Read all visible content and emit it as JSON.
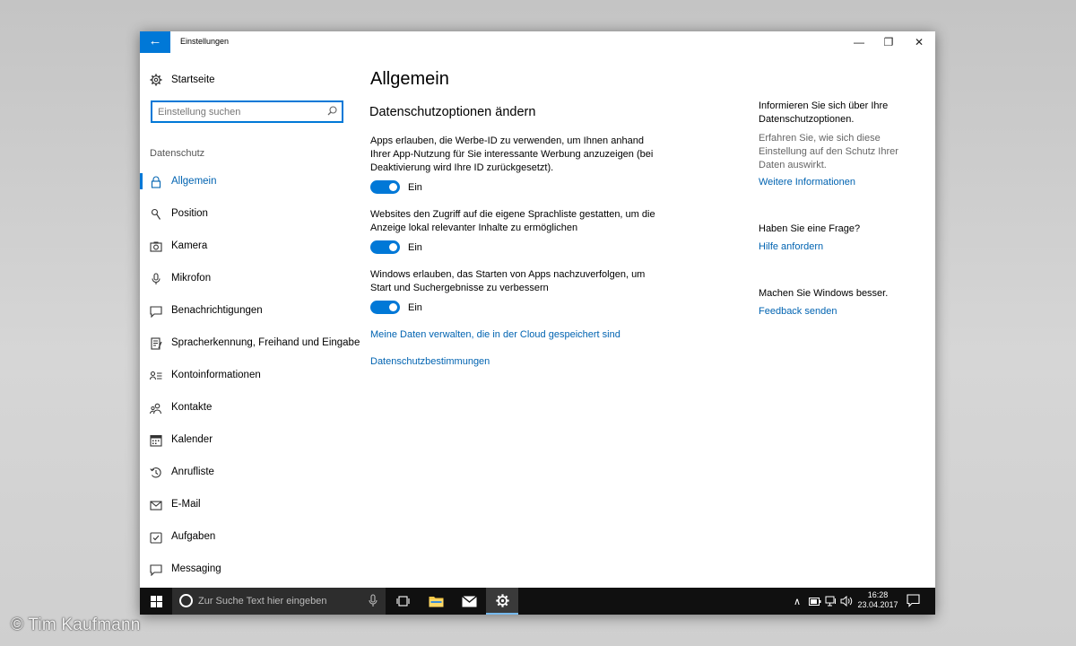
{
  "window": {
    "title": "Einstellungen",
    "back_glyph": "←",
    "minimize_glyph": "—",
    "maximize_glyph": "❐",
    "close_glyph": "✕"
  },
  "sidebar": {
    "home_label": "Startseite",
    "search_placeholder": "Einstellung suchen",
    "section_label": "Datenschutz",
    "items": [
      {
        "label": "Allgemein",
        "icon": "lock-icon",
        "active": true
      },
      {
        "label": "Position",
        "icon": "location-icon"
      },
      {
        "label": "Kamera",
        "icon": "camera-icon"
      },
      {
        "label": "Mikrofon",
        "icon": "microphone-icon"
      },
      {
        "label": "Benachrichtigungen",
        "icon": "notification-icon"
      },
      {
        "label": "Spracherkennung, Freihand und Eingabe",
        "icon": "speech-icon"
      },
      {
        "label": "Kontoinformationen",
        "icon": "account-info-icon"
      },
      {
        "label": "Kontakte",
        "icon": "contacts-icon"
      },
      {
        "label": "Kalender",
        "icon": "calendar-icon"
      },
      {
        "label": "Anrufliste",
        "icon": "call-history-icon"
      },
      {
        "label": "E-Mail",
        "icon": "mail-icon"
      },
      {
        "label": "Aufgaben",
        "icon": "tasks-icon"
      },
      {
        "label": "Messaging",
        "icon": "messaging-icon"
      }
    ]
  },
  "main": {
    "title": "Allgemein",
    "subtitle": "Datenschutzoptionen ändern",
    "options": [
      {
        "description": "Apps erlauben, die Werbe-ID zu verwenden, um Ihnen anhand Ihrer App-Nutzung für Sie interessante Werbung anzuzeigen (bei Deaktivierung wird Ihre ID zurückgesetzt).",
        "state": "Ein",
        "on": true
      },
      {
        "description": "Websites den Zugriff auf die eigene Sprachliste gestatten, um die Anzeige lokal relevanter Inhalte zu ermöglichen",
        "state": "Ein",
        "on": true
      },
      {
        "description": "Windows erlauben, das Starten von Apps nachzuverfolgen, um Start und Suchergebnisse zu verbessern",
        "state": "Ein",
        "on": true
      }
    ],
    "links": [
      "Meine Daten verwalten, die in der Cloud gespeichert sind",
      "Datenschutzbestimmungen"
    ]
  },
  "aside": {
    "info_heading": "Informieren Sie sich über Ihre Datenschutzoptionen.",
    "info_text": "Erfahren Sie, wie sich diese Einstellung auf den Schutz Ihrer Daten auswirkt.",
    "info_link": "Weitere Informationen",
    "question_heading": "Haben Sie eine Frage?",
    "question_link": "Hilfe anfordern",
    "feedback_heading": "Machen Sie Windows besser.",
    "feedback_link": "Feedback senden"
  },
  "taskbar": {
    "search_placeholder": "Zur Suche Text hier eingeben",
    "time": "16:28",
    "date": "23.04.2017",
    "tray_chevron": "∧",
    "volume_glyph": "🔊"
  },
  "watermark": "© Tim Kaufmann",
  "colors": {
    "accent": "#0078d7",
    "link": "#0063b1",
    "taskbar": "#101010"
  }
}
